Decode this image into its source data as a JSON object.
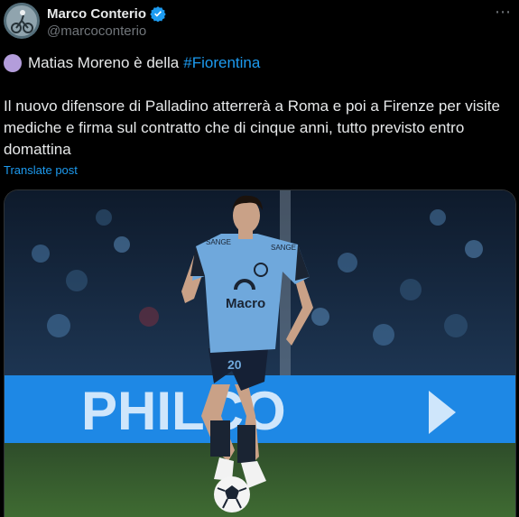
{
  "author": {
    "name": "Marco Conterio",
    "handle": "@marcoconterio",
    "verified": true
  },
  "more_icon": "⋯",
  "post": {
    "headline_text": "Matias Moreno è della",
    "hashtag": "#Fiorentina",
    "body": "Il nuovo difensore di Palladino atterrerà a Roma e poi a Firenze per visite mediche e firma sul contratto che di cinque anni, tutto previsto entro domattina",
    "translate_label": "Translate post"
  },
  "media": {
    "description_icon": "photo",
    "shirt_sponsor": "Macro",
    "shirt_brand_left": "SANGE",
    "shirt_brand_right": "SANGE",
    "shirt_number": "20",
    "board_text": "PHILCO",
    "colors": {
      "shirt": "#6fa8dc",
      "board": "#1e88e5",
      "pitch": "#2e4d2a"
    }
  }
}
